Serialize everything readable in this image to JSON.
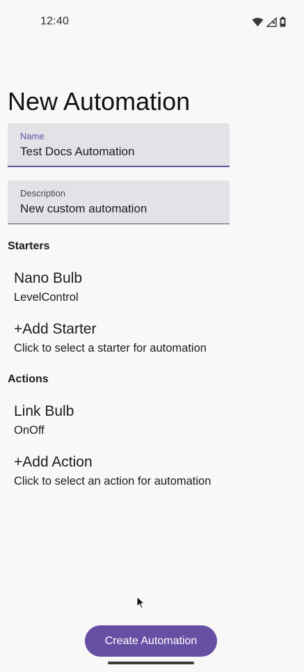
{
  "status_bar": {
    "time": "12:40",
    "icons": [
      "wifi-icon",
      "cell-signal-icon",
      "battery-icon"
    ]
  },
  "page": {
    "title": "New Automation"
  },
  "form": {
    "name": {
      "label": "Name",
      "value": "Test Docs Automation"
    },
    "description": {
      "label": "Description",
      "value": "New custom automation"
    }
  },
  "starters": {
    "heading": "Starters",
    "items": [
      {
        "title": "Nano Bulb",
        "subtitle": "LevelControl"
      },
      {
        "title": "+Add Starter",
        "subtitle": "Click to select a starter for automation"
      }
    ]
  },
  "actions": {
    "heading": "Actions",
    "items": [
      {
        "title": "Link Bulb",
        "subtitle": "OnOff"
      },
      {
        "title": "+Add Action",
        "subtitle": "Click to select an action for automation"
      }
    ]
  },
  "footer": {
    "create_label": "Create Automation"
  },
  "colors": {
    "primary": "#6750a4",
    "field_bg": "#e2e2e7",
    "background": "#f8f8f8"
  }
}
